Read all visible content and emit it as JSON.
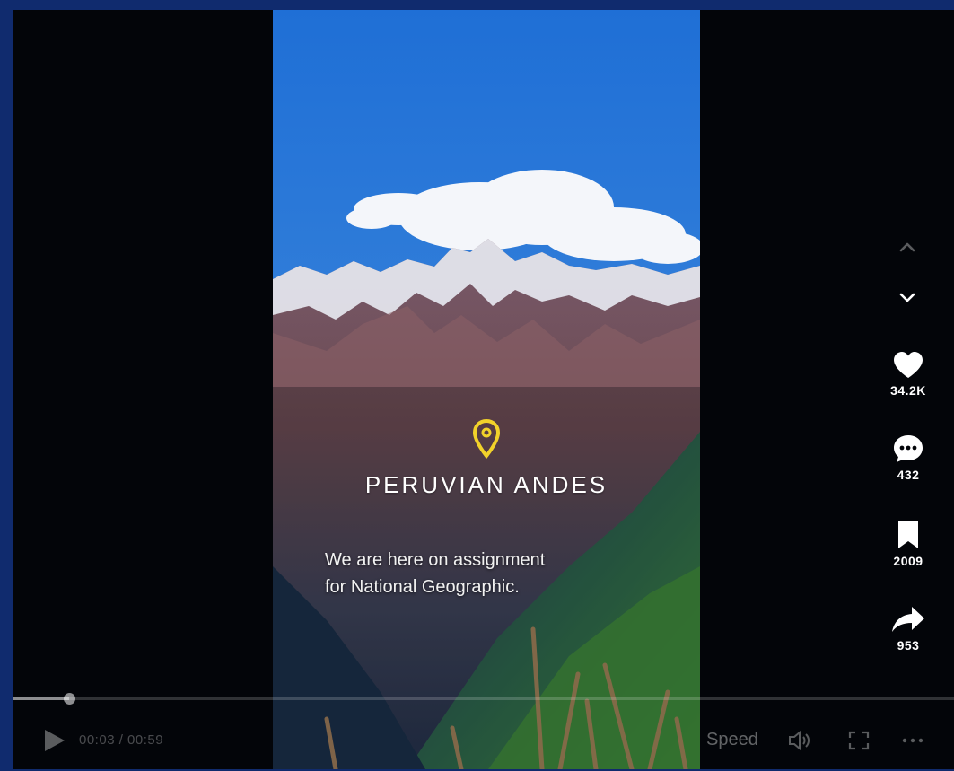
{
  "video": {
    "location_title": "PERUVIAN ANDES",
    "caption_line1": "We are here on assignment",
    "caption_line2": "for National Geographic.",
    "pin_color": "#f2d22a",
    "progress_fraction": 0.06
  },
  "nav": {
    "up_icon": "chevron-up-icon",
    "down_icon": "chevron-down-icon"
  },
  "actions": {
    "like_count": "34.2K",
    "comment_count": "432",
    "save_count": "2009",
    "share_count": "953"
  },
  "controls": {
    "time": "00:03 / 00:59",
    "speed_label": "Speed",
    "icons": [
      "play-icon",
      "volume-icon",
      "fullscreen-icon",
      "more-icon"
    ]
  }
}
